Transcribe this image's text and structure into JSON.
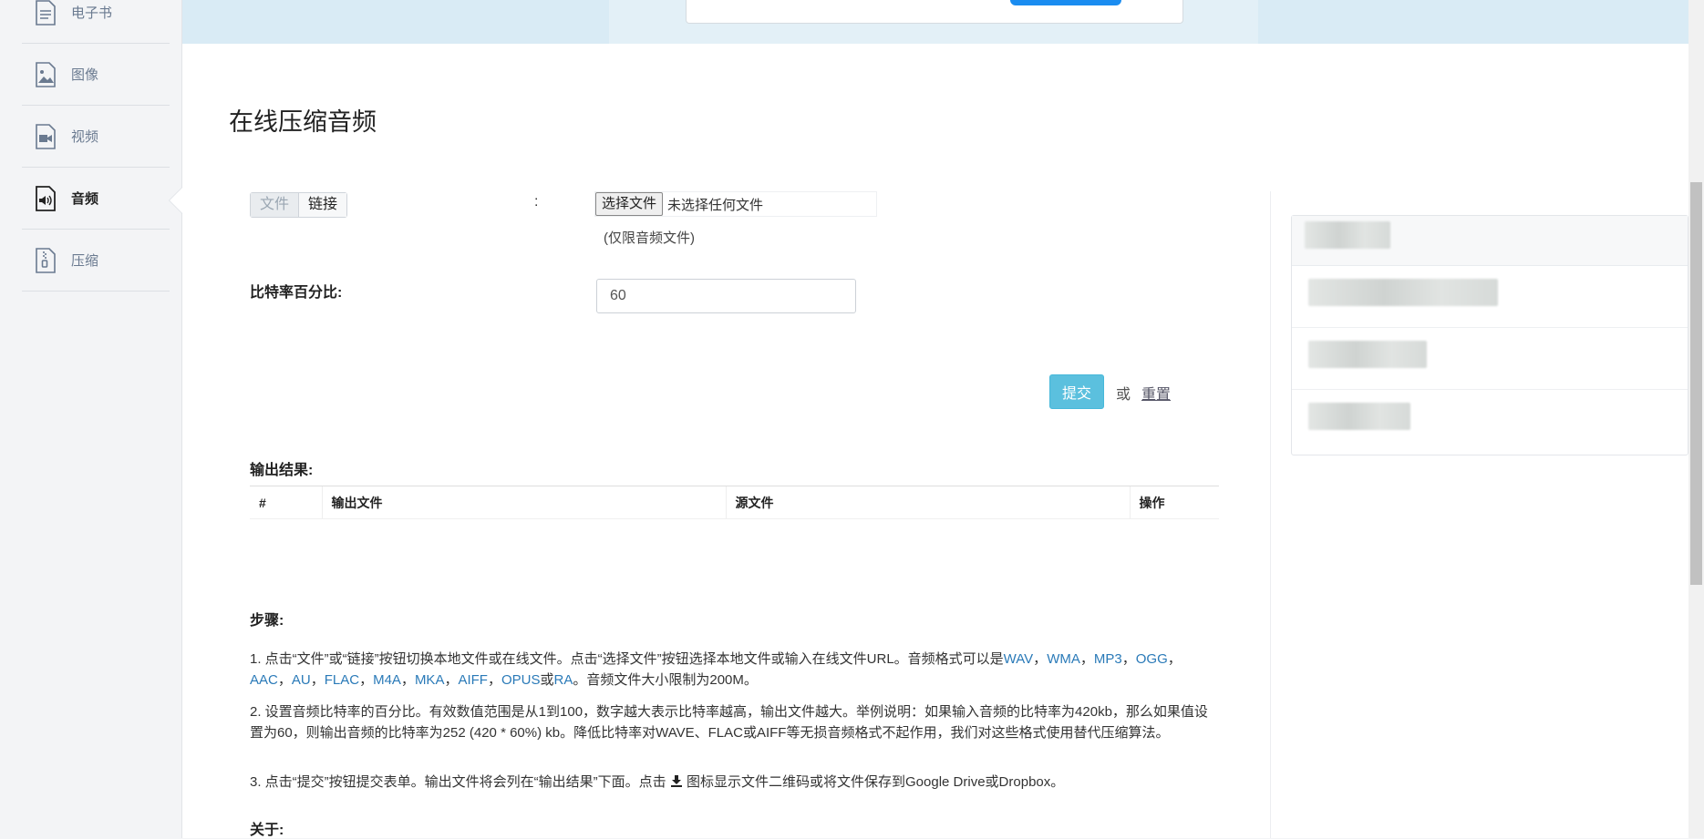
{
  "sidebar": {
    "items": [
      {
        "label": "电子书",
        "icon": "ebook-icon"
      },
      {
        "label": "图像",
        "icon": "image-icon"
      },
      {
        "label": "视频",
        "icon": "video-icon"
      },
      {
        "label": "音频",
        "icon": "audio-icon",
        "active": true
      },
      {
        "label": "压缩",
        "icon": "archive-icon"
      }
    ]
  },
  "page": {
    "title": "在线压缩音频"
  },
  "form": {
    "toggle_file": "文件",
    "toggle_link": "链接",
    "colon": ":",
    "choose_file_label": "选择文件",
    "no_file_text": "未选择任何文件",
    "hint": "(仅限音频文件)",
    "bitrate_label": "比特率百分比:",
    "bitrate_value": "60",
    "submit_label": "提交",
    "or_text": "或",
    "reset_label": "重置"
  },
  "output": {
    "label": "输出结果:",
    "columns": [
      "#",
      "输出文件",
      "源文件",
      "操作"
    ]
  },
  "steps": {
    "label": "步骤:",
    "step1_pre": "1. 点击“文件”或“链接”按钮切换本地文件或在线文件。点击“选择文件”按钮选择本地文件或输入在线文件URL。音频格式可以是",
    "formats": [
      "WAV",
      "WMA",
      "MP3",
      "OGG",
      "AAC",
      "AU",
      "FLAC",
      "M4A",
      "MKA",
      "AIFF",
      "OPUS"
    ],
    "format_sep": "，",
    "format_or": "或",
    "format_last": "RA",
    "step1_post": "。音频文件大小限制为200M。",
    "step2": "2. 设置音频比特率的百分比。有效数值范围是从1到100，数字越大表示比特率越高，输出文件越大。举例说明：如果输入音频的比特率为420kb，那么如果值设置为60，则输出音频的比特率为252 (420 * 60%) kb。降低比特率对WAVE、FLAC或AIFF等无损音频格式不起作用，我们对这些格式使用替代压缩算法。",
    "step3_pre": "3. 点击“提交”按钮提交表单。输出文件将会列在“输出结果”下面。点击",
    "step3_post": "图标显示文件二维码或将文件保存到Google Drive或Dropbox。",
    "about_label": "关于:"
  },
  "colors": {
    "accent": "#5bc0de",
    "link": "#2a7ab8",
    "banner": "#d9ebf5"
  }
}
